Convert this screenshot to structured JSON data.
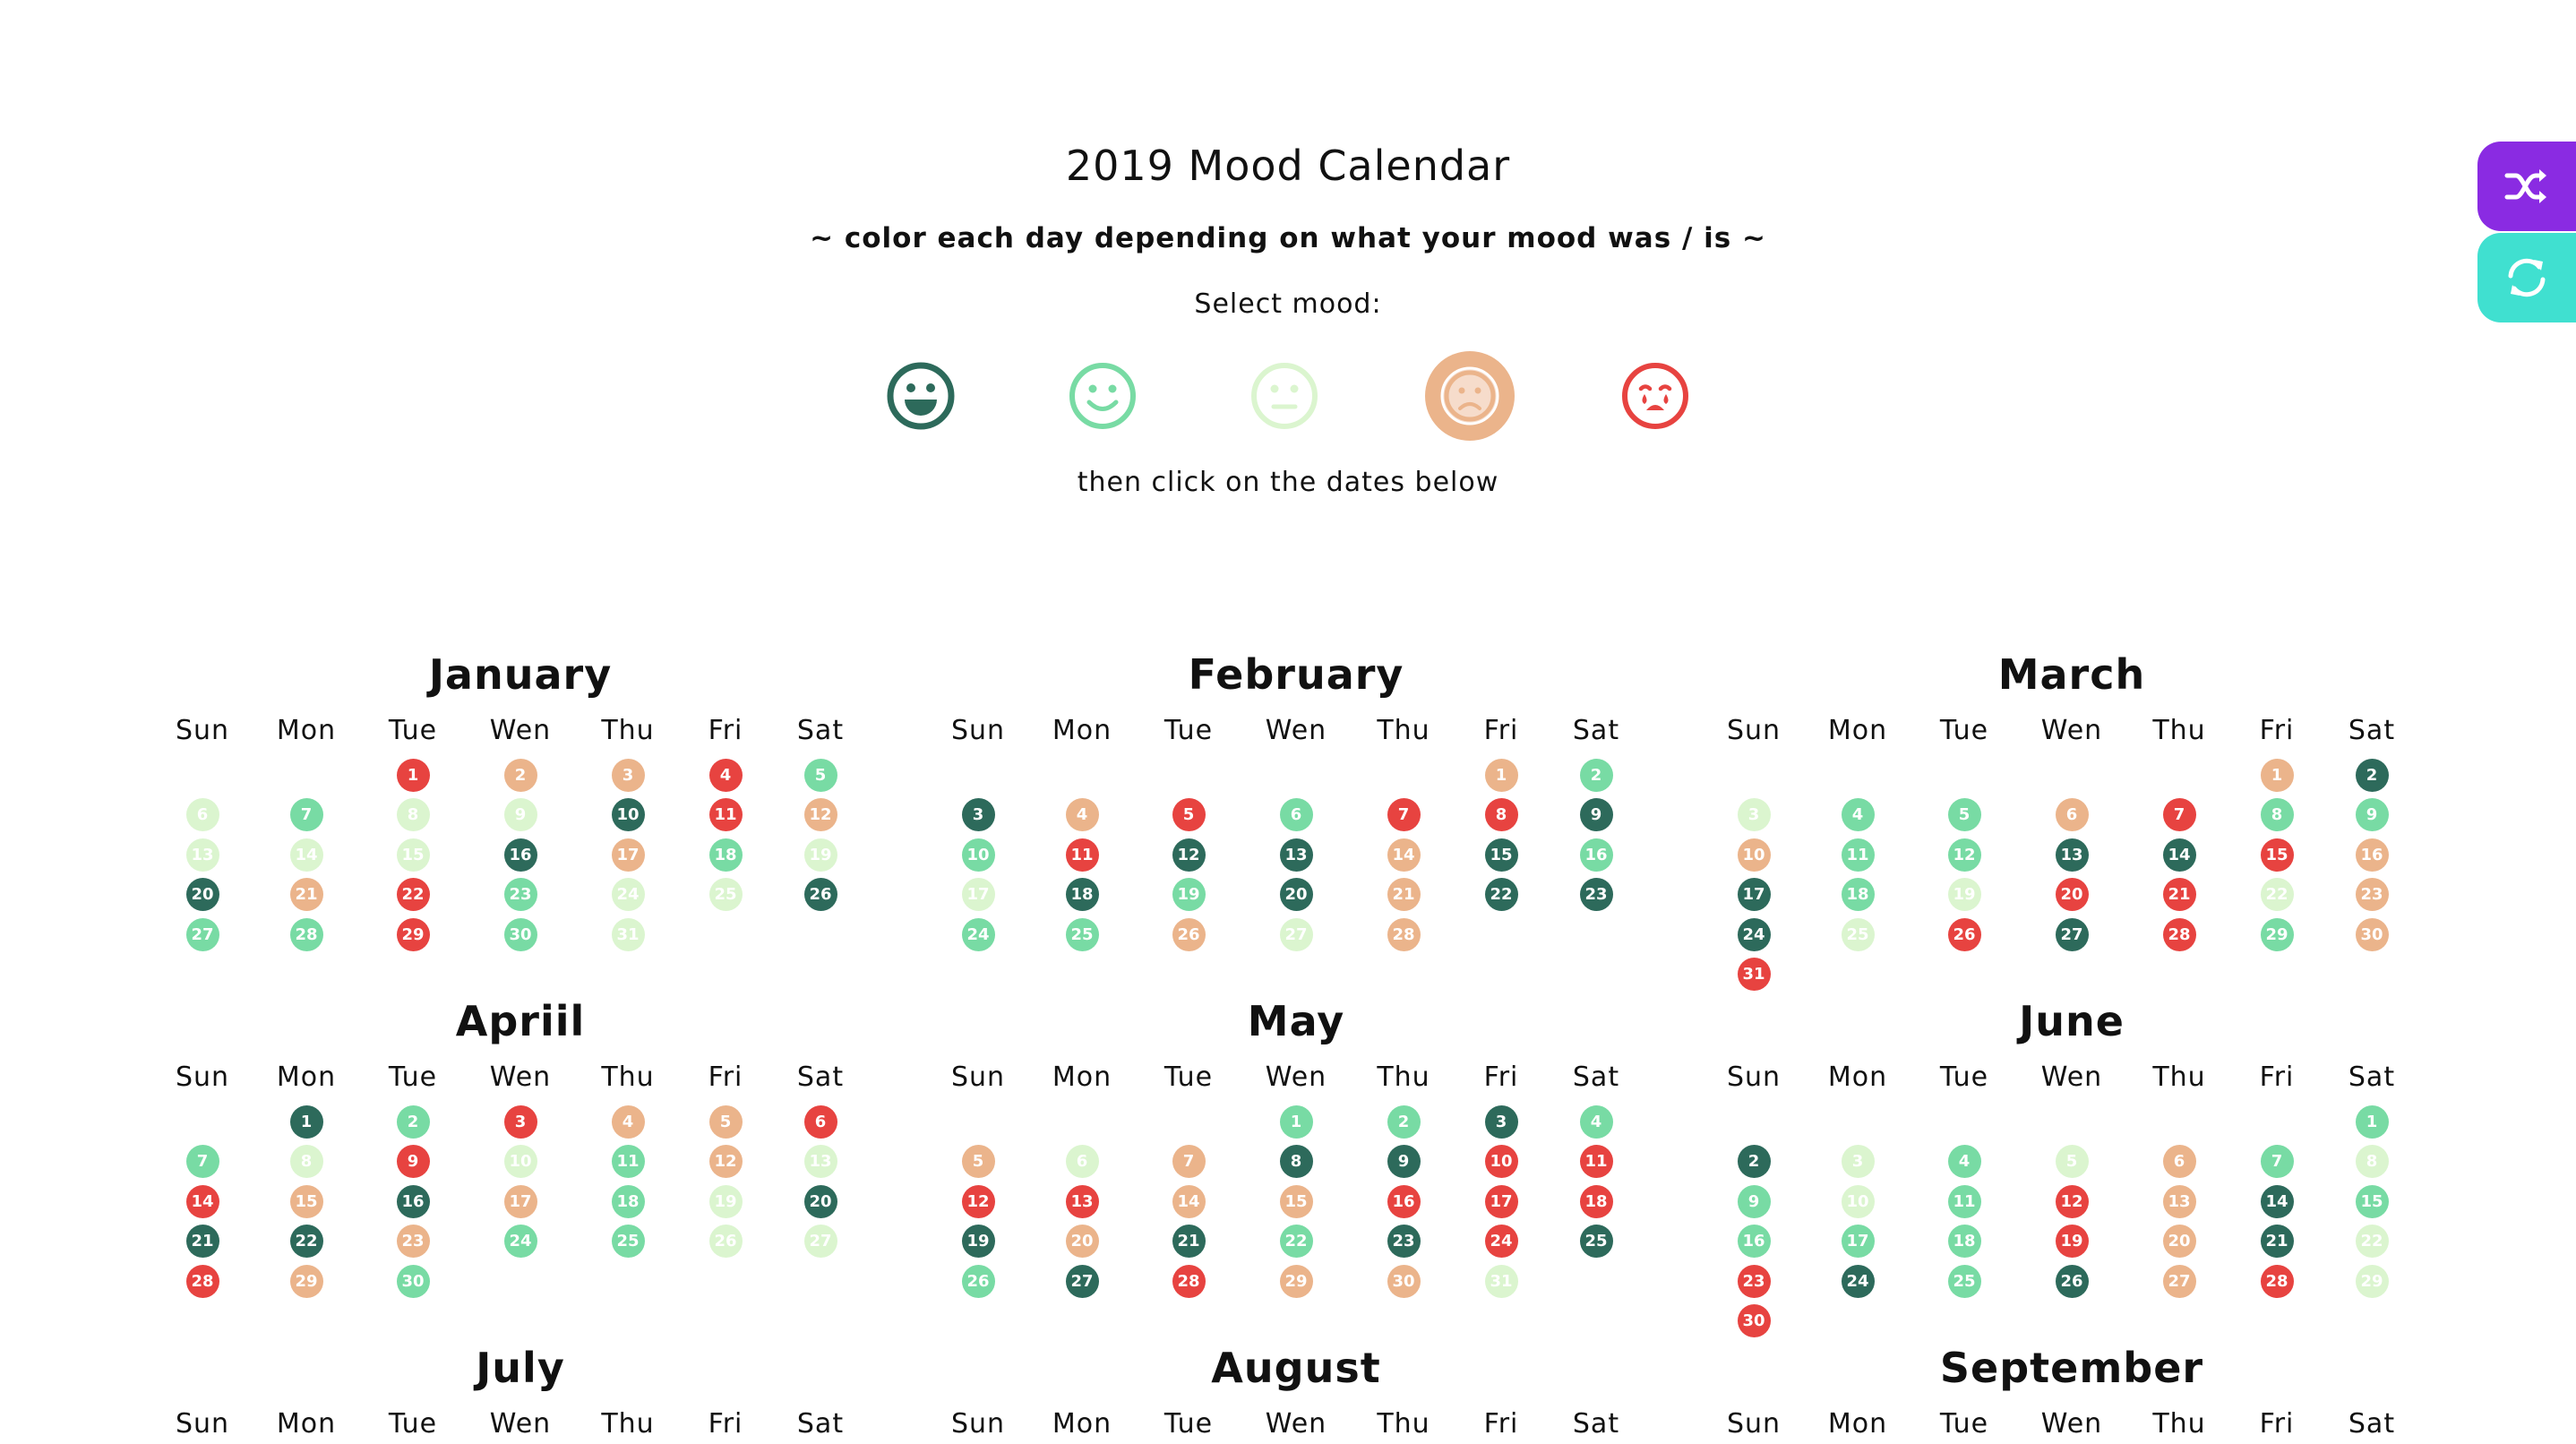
{
  "header": {
    "title": "2019 Mood Calendar",
    "subtitle": "~ color each day depending on what your mood was / is ~",
    "select_label": "Select mood:",
    "then_label": "then click on the dates below"
  },
  "moods": [
    {
      "name": "very-happy",
      "icon": "grin-icon",
      "color": "#2d6a5b"
    },
    {
      "name": "happy",
      "icon": "smile-icon",
      "color": "#78dba4"
    },
    {
      "name": "neutral",
      "icon": "meh-icon",
      "color": "#dbf5cf"
    },
    {
      "name": "sad",
      "icon": "frown-icon",
      "color": "#ebb48b",
      "selected": true
    },
    {
      "name": "very-sad",
      "icon": "crying-icon",
      "color": "#e74340"
    }
  ],
  "mood_colors": [
    "",
    "#2d6a5b",
    "#78dba4",
    "#dbf5cf",
    "#ebb48b",
    "#e74340"
  ],
  "side_buttons": {
    "shuffle": {
      "icon": "shuffle-icon",
      "color": "#8a2be2"
    },
    "refresh": {
      "icon": "refresh-icon",
      "color": "#40e0d0"
    }
  },
  "weekdays": [
    "Sun",
    "Mon",
    "Tue",
    "Wen",
    "Thu",
    "Fri",
    "Sat"
  ],
  "months": [
    {
      "name": "January",
      "start": 2,
      "days": 31,
      "moods": [
        5,
        4,
        4,
        5,
        2,
        3,
        2,
        3,
        3,
        1,
        5,
        4,
        3,
        3,
        3,
        1,
        4,
        2,
        3,
        1,
        4,
        5,
        2,
        3,
        3,
        1,
        2,
        2,
        5,
        2,
        3
      ]
    },
    {
      "name": "February",
      "start": 5,
      "days": 28,
      "moods": [
        4,
        2,
        1,
        4,
        5,
        2,
        5,
        5,
        1,
        2,
        5,
        1,
        1,
        4,
        1,
        2,
        3,
        1,
        2,
        1,
        4,
        1,
        1,
        2,
        2,
        4,
        3,
        4
      ]
    },
    {
      "name": "March",
      "start": 5,
      "days": 31,
      "moods": [
        4,
        1,
        3,
        2,
        2,
        4,
        5,
        2,
        2,
        4,
        2,
        2,
        1,
        1,
        5,
        4,
        1,
        2,
        3,
        5,
        5,
        3,
        4,
        1,
        3,
        5,
        1,
        5,
        2,
        4,
        5
      ]
    },
    {
      "name": "Apriil",
      "start": 1,
      "days": 30,
      "moods": [
        1,
        2,
        5,
        4,
        4,
        5,
        2,
        3,
        5,
        3,
        2,
        4,
        3,
        5,
        4,
        1,
        4,
        2,
        3,
        1,
        1,
        1,
        4,
        2,
        2,
        3,
        3,
        5,
        4,
        2
      ]
    },
    {
      "name": "May",
      "start": 3,
      "days": 31,
      "moods": [
        2,
        2,
        1,
        2,
        4,
        3,
        4,
        1,
        1,
        5,
        5,
        5,
        5,
        4,
        4,
        5,
        5,
        5,
        1,
        4,
        1,
        2,
        1,
        5,
        1,
        2,
        1,
        5,
        4,
        4,
        3
      ]
    },
    {
      "name": "June",
      "start": 6,
      "days": 30,
      "moods": [
        2,
        1,
        3,
        2,
        3,
        4,
        2,
        3,
        2,
        3,
        2,
        5,
        4,
        1,
        2,
        2,
        2,
        2,
        5,
        4,
        1,
        3,
        5,
        1,
        2,
        1,
        4,
        5,
        3,
        5,
        4
      ]
    },
    {
      "name": "July",
      "start": 1,
      "days": 0,
      "moods": []
    },
    {
      "name": "August",
      "start": 4,
      "days": 0,
      "moods": []
    },
    {
      "name": "September",
      "start": 0,
      "days": 0,
      "moods": []
    }
  ]
}
